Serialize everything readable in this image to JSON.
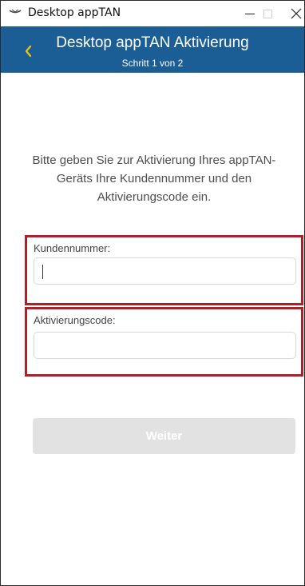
{
  "window": {
    "title": "Desktop appTAN"
  },
  "header": {
    "title": "Desktop appTAN Aktivierung",
    "subtitle": "Schritt 1 von 2",
    "background": "#1b5e95",
    "back_icon": "chevron-left-icon",
    "back_icon_color": "#f0c419"
  },
  "form": {
    "instructions": "Bitte geben Sie zur Aktivierung Ihres appTAN-Geräts Ihre Kundennummer und den Aktivierungscode ein.",
    "customer_number": {
      "label": "Kundennummer:",
      "value": ""
    },
    "activation_code": {
      "label": "Aktivierungscode:",
      "value": ""
    },
    "highlight_color": "#b01e2a",
    "continue_label": "Weiter"
  }
}
